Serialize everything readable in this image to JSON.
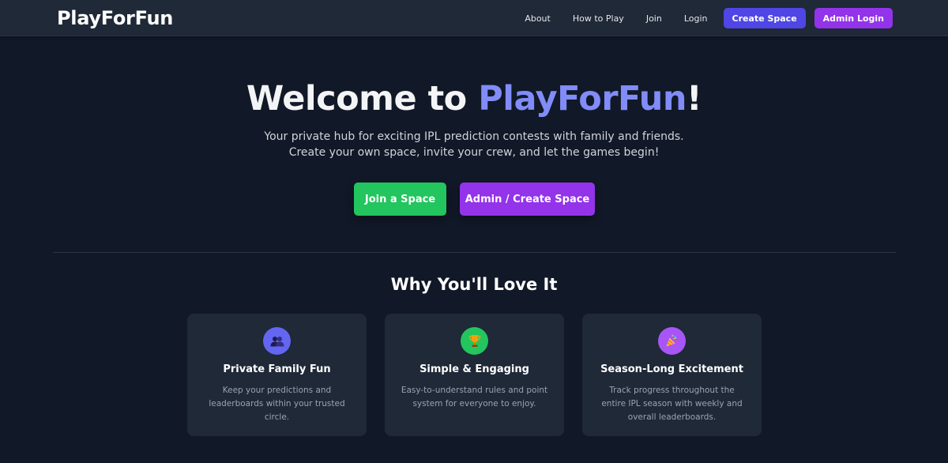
{
  "nav": {
    "logo": "PlayForFun",
    "links": [
      "About",
      "How to Play",
      "Join",
      "Login"
    ],
    "create_space_label": "Create Space",
    "admin_login_label": "Admin Login"
  },
  "hero": {
    "title_prefix": "Welcome to ",
    "title_accent": "PlayForFun",
    "title_suffix": "!",
    "subtitle_line1": "Your private hub for exciting IPL prediction contests with family and friends.",
    "subtitle_line2": "Create your own space, invite your crew, and let the games begin!",
    "join_button": "Join a Space",
    "admin_button": "Admin / Create Space"
  },
  "features": {
    "title": "Why You'll Love It",
    "cards": [
      {
        "icon": "people-icon",
        "title": "Private Family Fun",
        "description": "Keep your predictions and leaderboards within your trusted circle."
      },
      {
        "icon": "trophy-icon",
        "title": "Simple & Engaging",
        "description": "Easy-to-understand rules and point system for everyone to enjoy."
      },
      {
        "icon": "celebration-icon",
        "title": "Season-Long Excitement",
        "description": "Track progress throughout the entire IPL season with weekly and overall leaderboards."
      }
    ]
  },
  "colors": {
    "background": "#111827",
    "navbar": "#1f2937",
    "accent": "#818cf8",
    "create_space": "#4f46e5",
    "admin": "#9333ea",
    "join": "#22c55e"
  }
}
